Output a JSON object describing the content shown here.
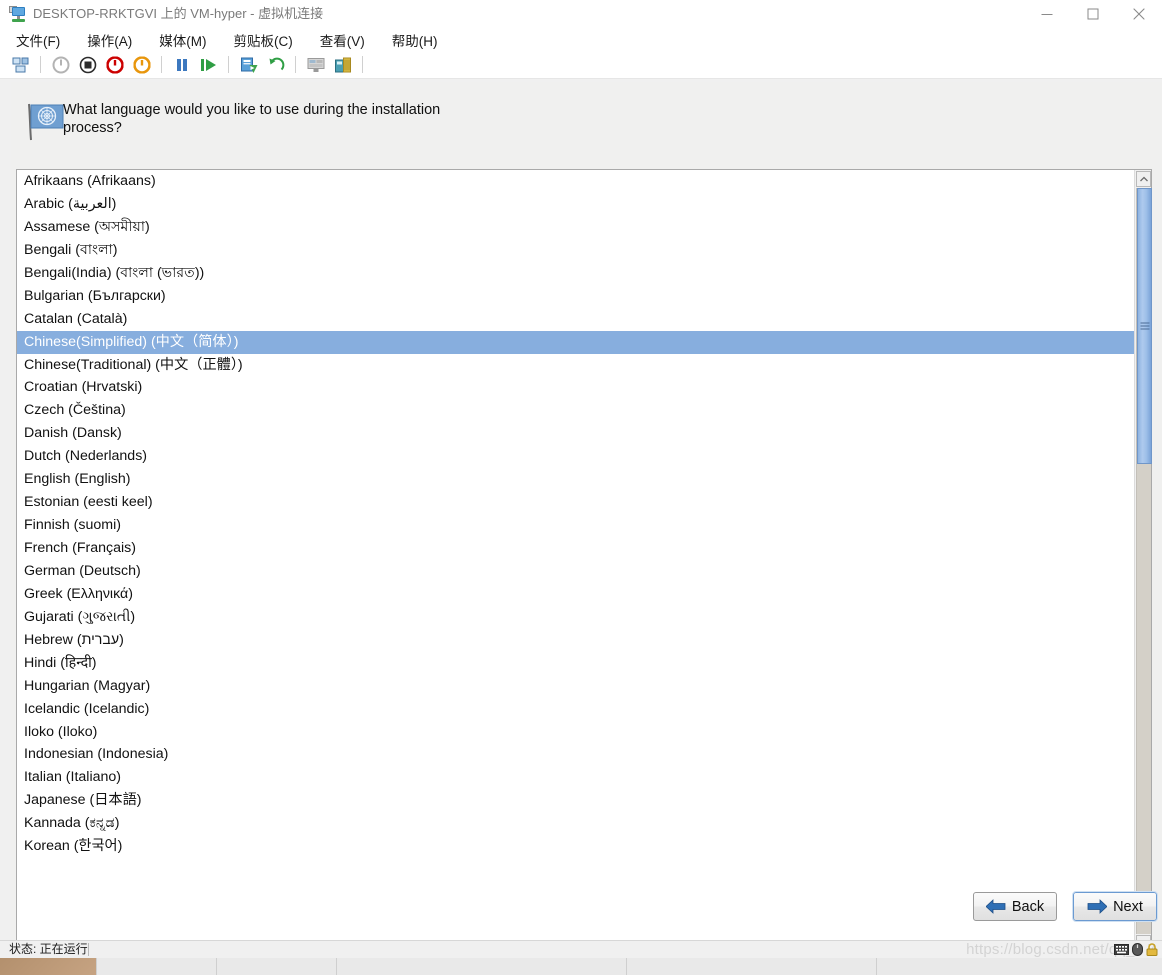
{
  "window": {
    "title": "DESKTOP-RRKTGVI 上的 VM-hyper - 虚拟机连接",
    "title_icon": "vm-connect-icon",
    "controls": {
      "minimize": "minimize-icon",
      "maximize": "maximize-icon",
      "close": "close-icon"
    }
  },
  "menubar": {
    "items": [
      {
        "label": "文件(F)",
        "name": "menu-file"
      },
      {
        "label": "操作(A)",
        "name": "menu-action"
      },
      {
        "label": "媒体(M)",
        "name": "menu-media"
      },
      {
        "label": "剪贴板(C)",
        "name": "menu-clipboard"
      },
      {
        "label": "查看(V)",
        "name": "menu-view"
      },
      {
        "label": "帮助(H)",
        "name": "menu-help"
      }
    ]
  },
  "toolbar": {
    "buttons": [
      {
        "name": "ctrl-alt-del-icon",
        "title": "Ctrl+Alt+Del"
      },
      {
        "name": "power-off-icon",
        "title": "关机"
      },
      {
        "name": "stop-icon",
        "title": "关闭"
      },
      {
        "name": "shutdown-icon",
        "title": "关闭电源"
      },
      {
        "name": "start-power-icon",
        "title": "启动"
      },
      {
        "name": "pause-icon",
        "title": "暂停"
      },
      {
        "name": "resume-play-icon",
        "title": "继续"
      },
      {
        "name": "checkpoint-icon",
        "title": "检查点"
      },
      {
        "name": "revert-icon",
        "title": "还原"
      },
      {
        "name": "screen-icon",
        "title": "增强会话"
      },
      {
        "name": "media-icon",
        "title": "媒体"
      }
    ]
  },
  "installer": {
    "prompt": "What language would you like to use during the installation process?",
    "prompt_icon": "un-flag-icon",
    "selected_language": "Chinese(Simplified) (中文（简体）)",
    "languages": [
      "Afrikaans (Afrikaans)",
      "Arabic (العربية)",
      "Assamese (অসমীয়া)",
      "Bengali (বাংলা)",
      "Bengali(India) (বাংলা (ভারত))",
      "Bulgarian (Български)",
      "Catalan (Català)",
      "Chinese(Simplified) (中文（简体）)",
      "Chinese(Traditional) (中文（正體）)",
      "Croatian (Hrvatski)",
      "Czech (Čeština)",
      "Danish (Dansk)",
      "Dutch (Nederlands)",
      "English (English)",
      "Estonian (eesti keel)",
      "Finnish (suomi)",
      "French (Français)",
      "German (Deutsch)",
      "Greek (Ελληνικά)",
      "Gujarati (ગુજરાતી)",
      "Hebrew (עברית)",
      "Hindi (हिन्दी)",
      "Hungarian (Magyar)",
      "Icelandic (Icelandic)",
      "Iloko (Iloko)",
      "Indonesian (Indonesia)",
      "Italian (Italiano)",
      "Japanese (日本語)",
      "Kannada (ಕನ್ನಡ)",
      "Korean (한국어)"
    ],
    "buttons": {
      "back": "Back",
      "next": "Next"
    },
    "scrollbar": {
      "up_arrow": "scroll-up-icon",
      "down_arrow": "scroll-down-icon",
      "thumb_grip": "scroll-thumb-grip"
    }
  },
  "statusbar": {
    "status": "状态: 正在运行",
    "watermark": "https://blog.csdn.net/qq_3     7",
    "tray_icons": [
      "keyboard-icon",
      "mouse-icon",
      "lock-icon"
    ]
  },
  "colors": {
    "selection": "#87aede",
    "window_bg": "#f0f0f0",
    "guest_bg": "#f0f0ef",
    "list_bg": "#ffffff",
    "scroll_thumb": "#9dbfe8",
    "dock_accent": "#cf1322"
  }
}
